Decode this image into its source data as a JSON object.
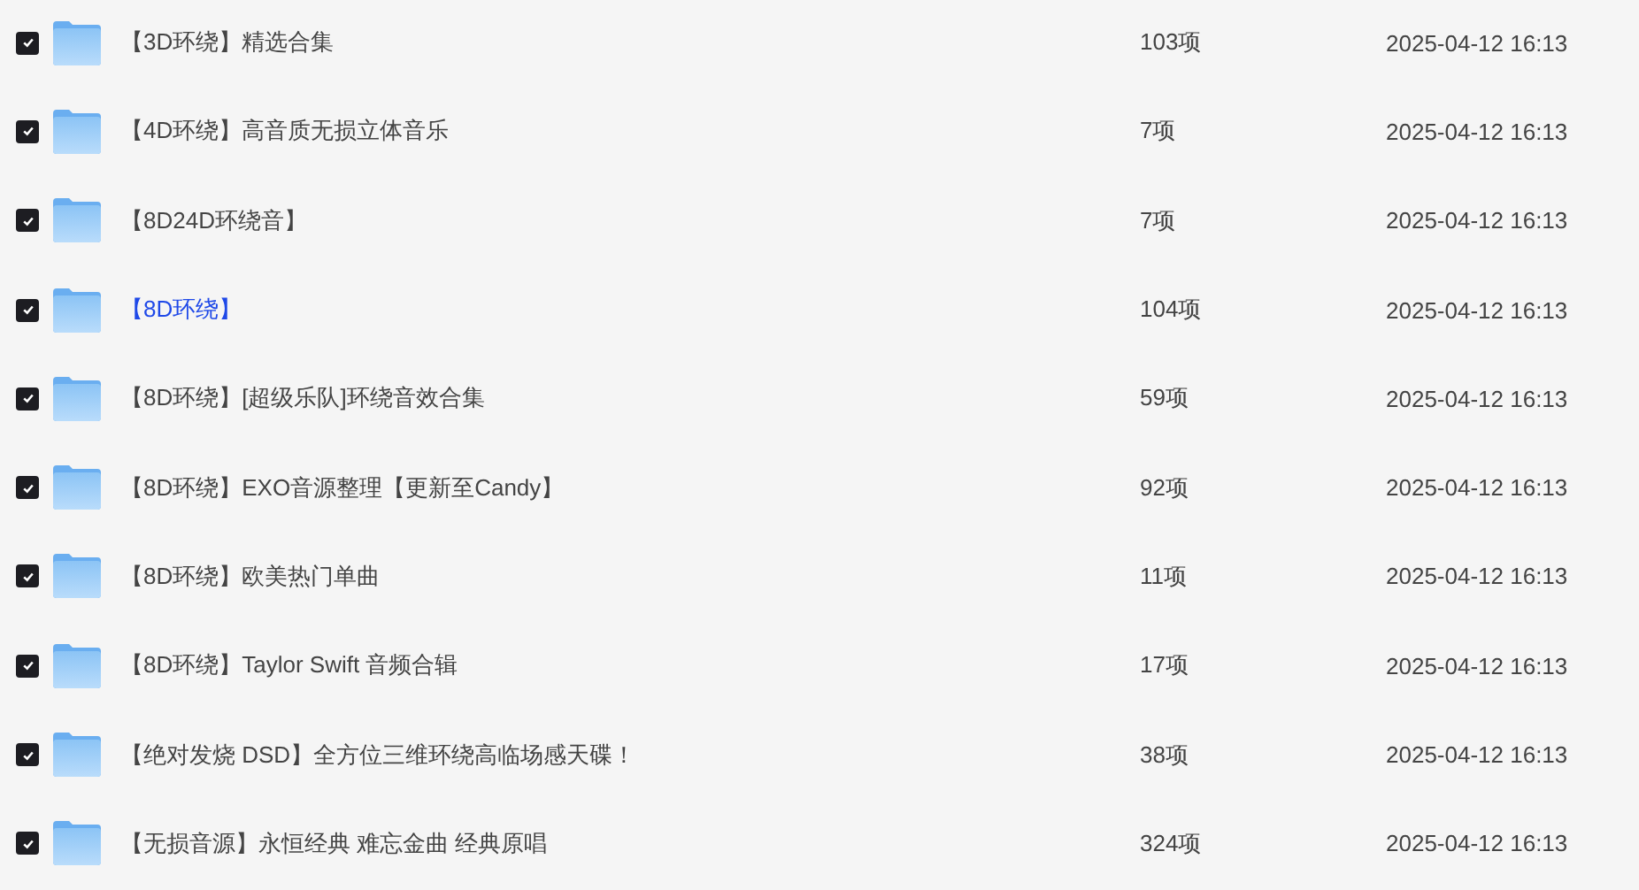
{
  "files": [
    {
      "name": "【3D环绕】精选合集",
      "count": "103项",
      "modified": "2025-04-12 16:13",
      "checked": true,
      "highlighted": false
    },
    {
      "name": "【4D环绕】高音质无损立体音乐",
      "count": "7项",
      "modified": "2025-04-12 16:13",
      "checked": true,
      "highlighted": false
    },
    {
      "name": "【8D24D环绕音】",
      "count": "7项",
      "modified": "2025-04-12 16:13",
      "checked": true,
      "highlighted": false
    },
    {
      "name": "【8D环绕】",
      "count": "104项",
      "modified": "2025-04-12 16:13",
      "checked": true,
      "highlighted": true
    },
    {
      "name": "【8D环绕】[超级乐队]环绕音效合集",
      "count": "59项",
      "modified": "2025-04-12 16:13",
      "checked": true,
      "highlighted": false
    },
    {
      "name": "【8D环绕】EXO音源整理【更新至Candy】",
      "count": "92项",
      "modified": "2025-04-12 16:13",
      "checked": true,
      "highlighted": false
    },
    {
      "name": "【8D环绕】欧美热门单曲",
      "count": "11项",
      "modified": "2025-04-12 16:13",
      "checked": true,
      "highlighted": false
    },
    {
      "name": "【8D环绕】Taylor Swift 音频合辑",
      "count": "17项",
      "modified": "2025-04-12 16:13",
      "checked": true,
      "highlighted": false
    },
    {
      "name": "【绝对发烧 DSD】全方位三维环绕高临场感天碟！",
      "count": "38项",
      "modified": "2025-04-12 16:13",
      "checked": true,
      "highlighted": false
    },
    {
      "name": "【无损音源】永恒经典 难忘金曲 经典原唱",
      "count": "324项",
      "modified": "2025-04-12 16:13",
      "checked": true,
      "highlighted": false
    }
  ]
}
